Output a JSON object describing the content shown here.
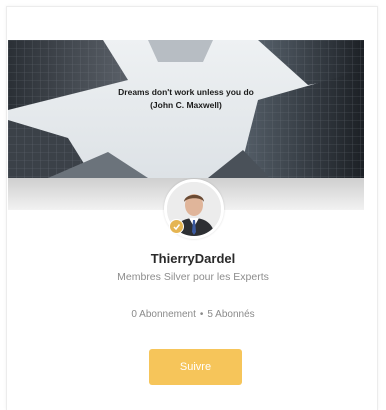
{
  "cover": {
    "quote_line1": "Dreams don't work unless you do",
    "quote_line2": "(John C. Maxwell)"
  },
  "profile": {
    "name": "ThierryDardel",
    "role": "Membres Silver pour les Experts",
    "badge_icon": "silver-badge-icon",
    "badge_color": "#e5b552"
  },
  "stats": {
    "following": "0 Abonnement",
    "separator": "•",
    "followers": "5 Abonnés"
  },
  "actions": {
    "follow_label": "Suivre",
    "follow_color": "#f6c55a"
  }
}
